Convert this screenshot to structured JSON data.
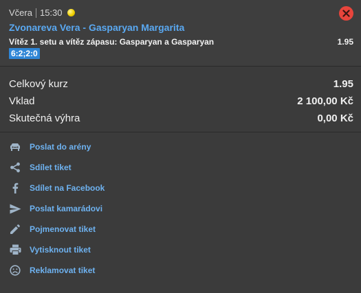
{
  "header": {
    "day": "Včera",
    "time": "15:30"
  },
  "bet": {
    "match": "Zvonareva Vera - Gasparyan Margarita",
    "selection": "Vítěz 1. setu a vítěz zápasu: Gasparyan a Gasparyan",
    "odd": "1.95",
    "score": "6:2;2:0"
  },
  "totals": {
    "rows": [
      {
        "label": "Celkový kurz",
        "value": "1.95"
      },
      {
        "label": "Vklad",
        "value": "2 100,00 Kč"
      },
      {
        "label": "Skutečná výhra",
        "value": "0,00 Kč"
      }
    ]
  },
  "actions": [
    {
      "label": "Poslat do arény",
      "icon": "arena-icon"
    },
    {
      "label": "Sdílet tiket",
      "icon": "share-icon"
    },
    {
      "label": "Sdílet na Facebook",
      "icon": "facebook-icon"
    },
    {
      "label": "Poslat kamarádovi",
      "icon": "send-icon"
    },
    {
      "label": "Pojmenovat tiket",
      "icon": "pencil-icon"
    },
    {
      "label": "Vytisknout tiket",
      "icon": "printer-icon"
    },
    {
      "label": "Reklamovat tiket",
      "icon": "sad-face-icon"
    }
  ],
  "colors": {
    "background": "#3b3b3b",
    "link": "#5aa9f2",
    "action_link": "#6eb2f0",
    "close": "#e8453c",
    "score_badge": "#2f86d6"
  }
}
